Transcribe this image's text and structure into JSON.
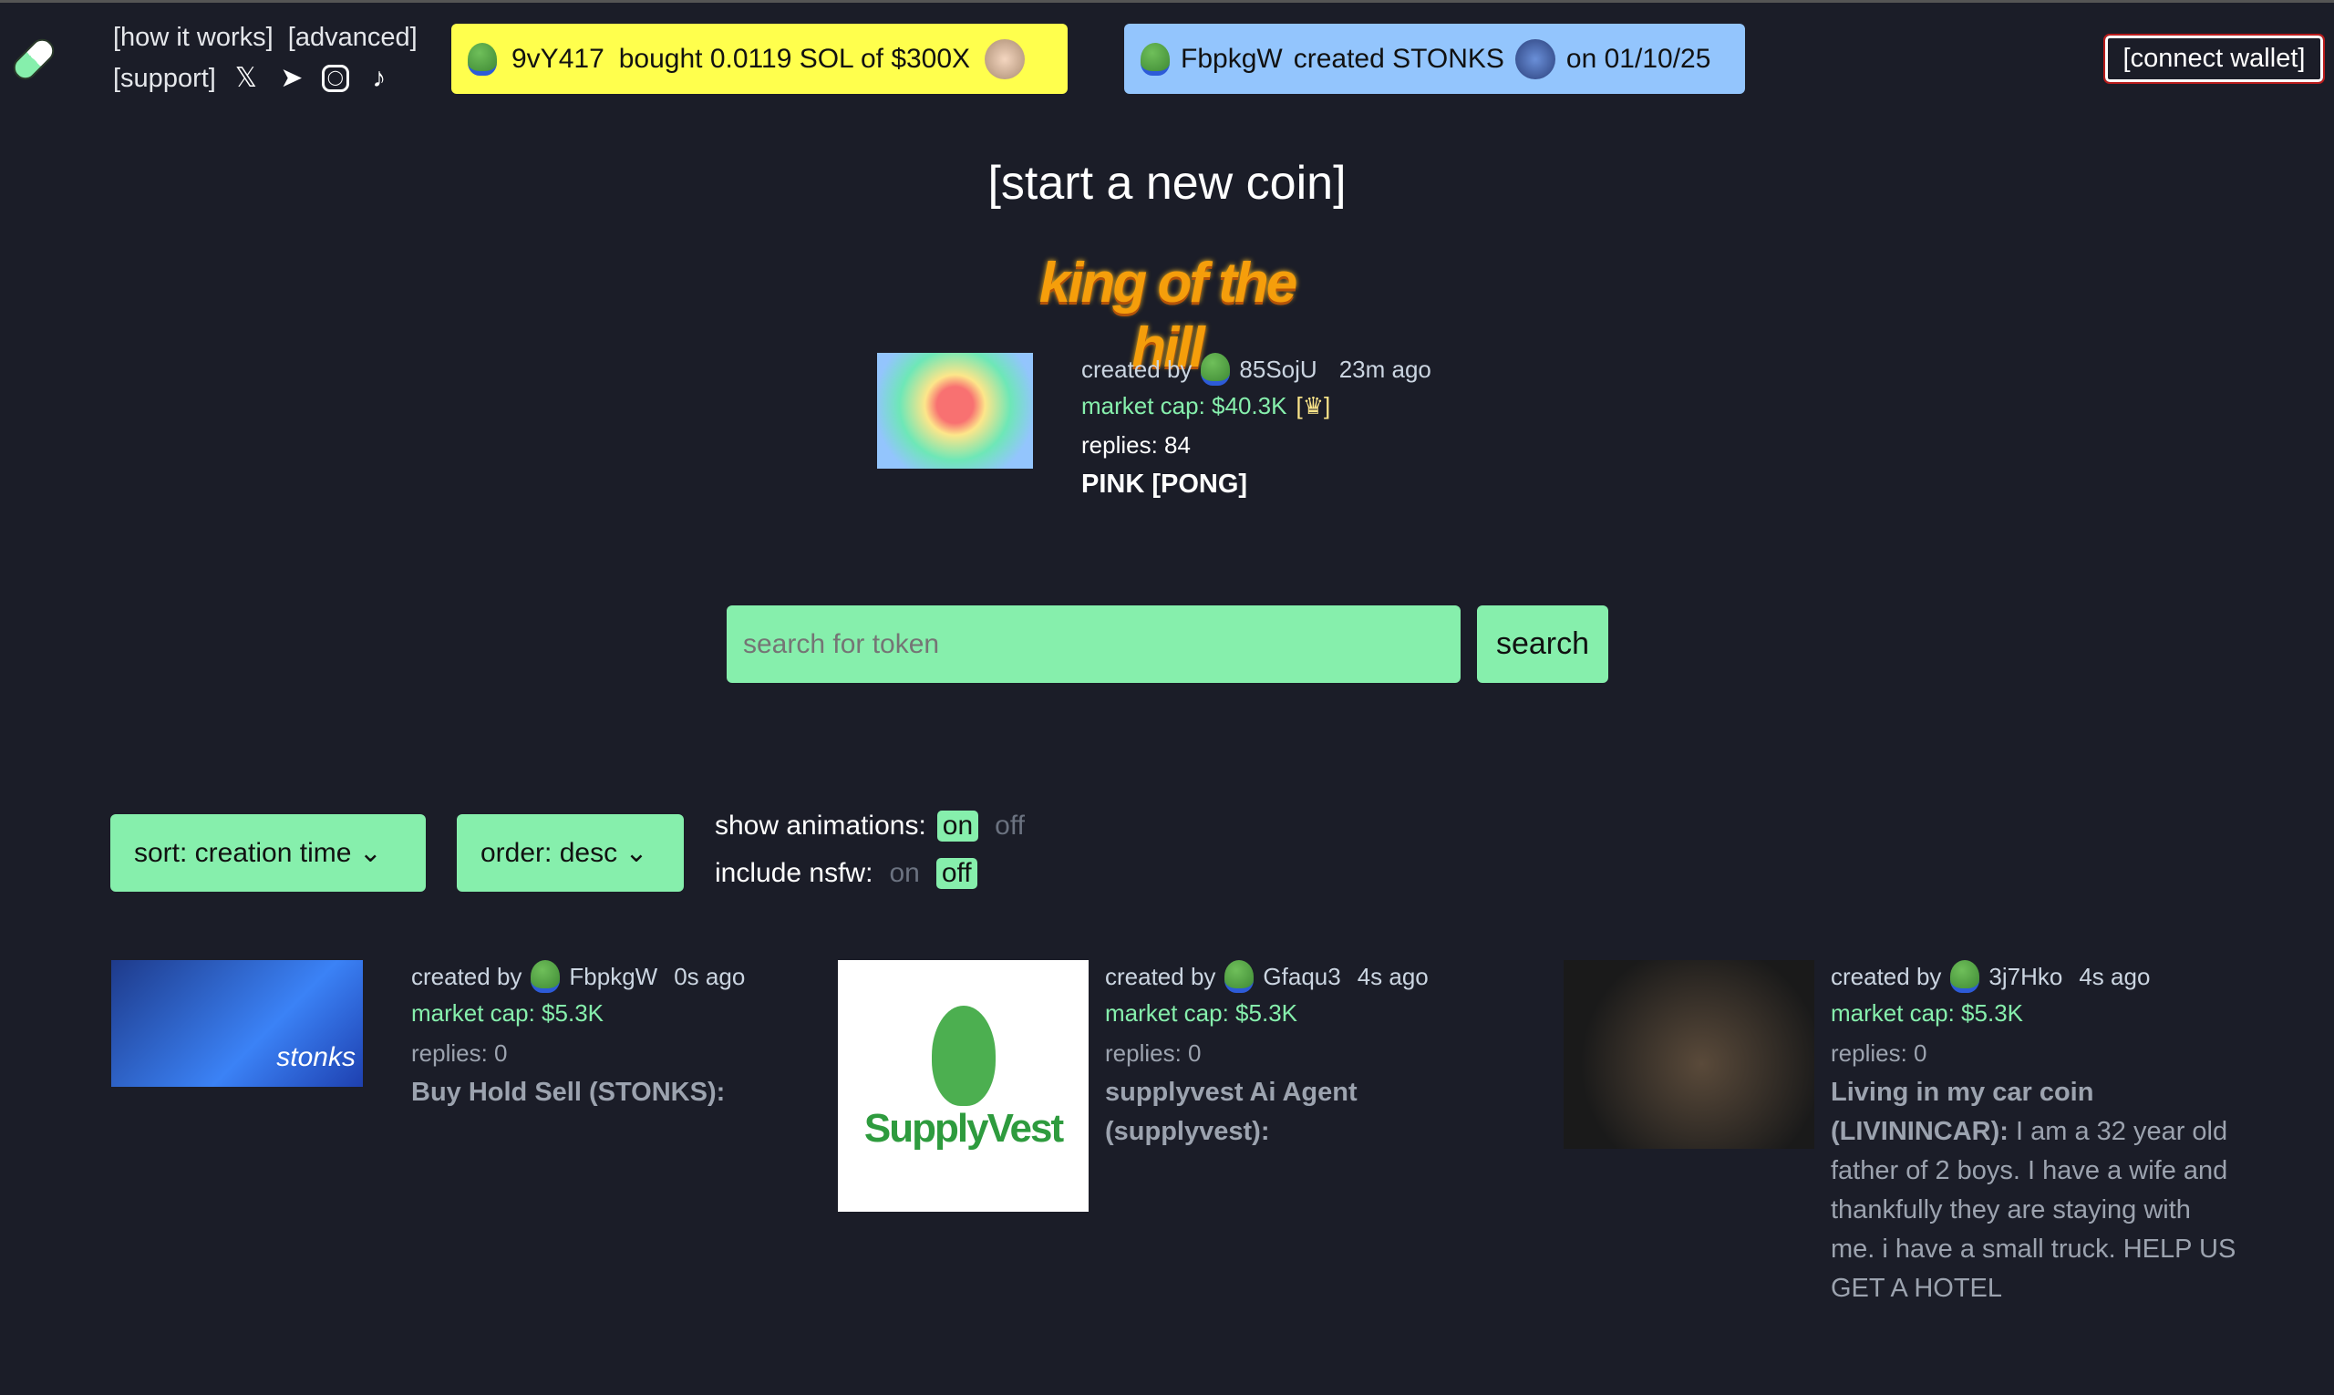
{
  "nav": {
    "how_it_works": "[how it works]",
    "advanced": "[advanced]",
    "support": "[support]",
    "social_icons": [
      "x-icon",
      "telegram-icon",
      "instagram-icon",
      "tiktok-icon"
    ]
  },
  "ticker_buy": {
    "user": "9vY417",
    "text": "bought 0.0119 SOL of $300X",
    "color": "#ffff4d"
  },
  "ticker_create": {
    "user": "FbpkgW",
    "text": "created STONKS",
    "date": "on 01/10/25",
    "color": "#93c5fd"
  },
  "connect_wallet": "[connect wallet]",
  "start_coin": "[start a new coin]",
  "king_of_the_hill": {
    "banner": "king of the hill",
    "created_by": "created by",
    "user": "85SojU",
    "age": "23m ago",
    "market_cap": "market cap: $40.3K",
    "replies": "replies: 84",
    "name": "PINK [PONG]"
  },
  "search": {
    "placeholder": "search for token",
    "button": "search"
  },
  "controls": {
    "sort": "sort: creation time",
    "order": "order: desc",
    "show_animations": "show animations:",
    "include_nsfw": "include nsfw:",
    "on": "on",
    "off": "off",
    "animations_state": "on",
    "nsfw_state": "off"
  },
  "coins": [
    {
      "created_by": "created by",
      "user": "FbpkgW",
      "age": "0s ago",
      "market_cap": "market cap: $5.3K",
      "replies": "replies: 0",
      "title": "Buy Hold Sell (STONKS):",
      "desc": "",
      "image_text": "stonks"
    },
    {
      "created_by": "created by",
      "user": "Gfaqu3",
      "age": "4s ago",
      "market_cap": "market cap: $5.3K",
      "replies": "replies: 0",
      "title": "supplyvest Ai Agent (supplyvest):",
      "desc": "",
      "image_text": "SupplyVest"
    },
    {
      "created_by": "created by",
      "user": "3j7Hko",
      "age": "4s ago",
      "market_cap": "market cap: $5.3K",
      "replies": "replies: 0",
      "title": "Living in my car coin (LIVININCAR):",
      "desc": "I am a 32 year old father of 2 boys. I have a wife and thankfully they are staying with me. i have a small truck. HELP US GET A HOTEL"
    }
  ]
}
